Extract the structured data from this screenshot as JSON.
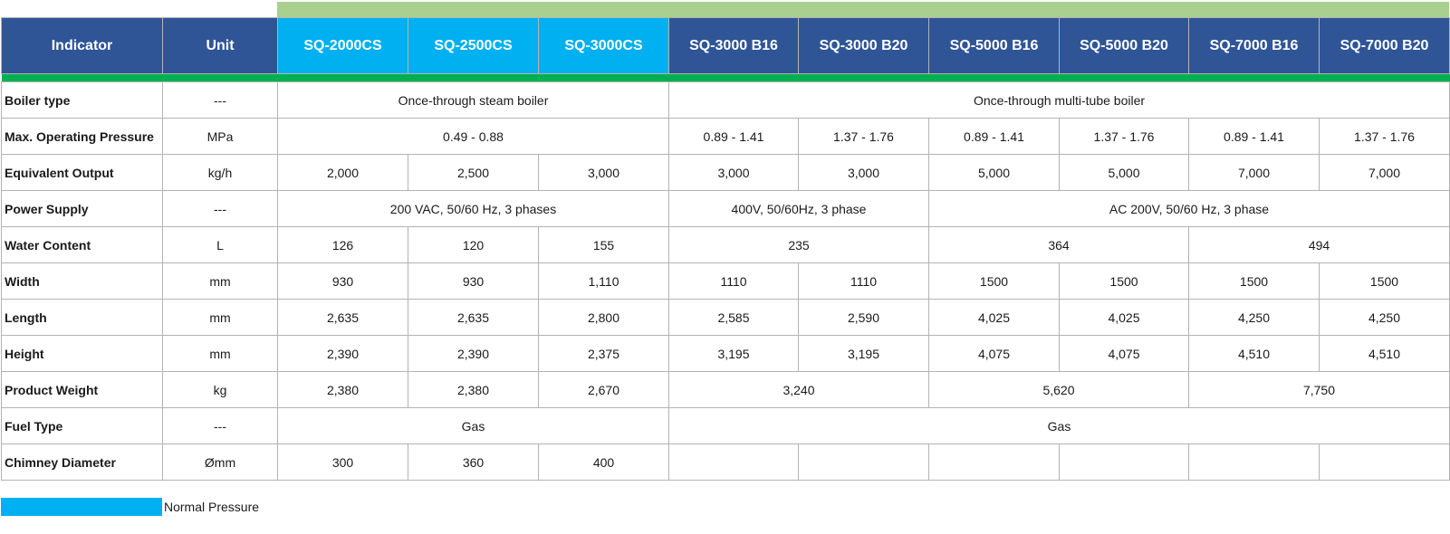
{
  "colors": {
    "header_dark": "#2f5597",
    "header_light": "#00b0f0",
    "top_bar": "#a9d08e",
    "accent_line": "#00b050",
    "border": "#b3b3b3"
  },
  "header": {
    "indicator": "Indicator",
    "unit": "Unit",
    "models": [
      "SQ-2000CS",
      "SQ-2500CS",
      "SQ-3000CS",
      "SQ-3000 B16",
      "SQ-3000 B20",
      "SQ-5000 B16",
      "SQ-5000 B20",
      "SQ-7000 B16",
      "SQ-7000 B20"
    ]
  },
  "rows": {
    "boiler_type": {
      "label": "Boiler type",
      "unit": "---",
      "cs": "Once-through steam boiler",
      "b": "Once-through multi-tube boiler"
    },
    "max_pressure": {
      "label": "Max. Operating Pressure",
      "unit": "MPa",
      "cs": "0.49 - 0.88",
      "b": [
        "0.89 - 1.41",
        "1.37 - 1.76",
        "0.89 - 1.41",
        "1.37 - 1.76",
        "0.89 - 1.41",
        "1.37 - 1.76"
      ]
    },
    "output": {
      "label": "Equivalent Output",
      "unit": "kg/h",
      "values": [
        "2,000",
        "2,500",
        "3,000",
        "3,000",
        "3,000",
        "5,000",
        "5,000",
        "7,000",
        "7,000"
      ]
    },
    "power": {
      "label": "Power Supply",
      "unit": "---",
      "cs": "200 VAC, 50/60 Hz, 3 phases",
      "b3000": "400V, 50/60Hz, 3 phase",
      "b5000_7000": "AC 200V, 50/60 Hz, 3 phase"
    },
    "water": {
      "label": "Water Content",
      "unit": "L",
      "cs": [
        "126",
        "120",
        "155"
      ],
      "b3000": "235",
      "b5000": "364",
      "b7000": "494"
    },
    "width": {
      "label": "Width",
      "unit": "mm",
      "values": [
        "930",
        "930",
        "1,110",
        "1110",
        "1110",
        "1500",
        "1500",
        "1500",
        "1500"
      ]
    },
    "length": {
      "label": "Length",
      "unit": "mm",
      "values": [
        "2,635",
        "2,635",
        "2,800",
        "2,585",
        "2,590",
        "4,025",
        "4,025",
        "4,250",
        "4,250"
      ]
    },
    "height": {
      "label": "Height",
      "unit": "mm",
      "values": [
        "2,390",
        "2,390",
        "2,375",
        "3,195",
        "3,195",
        "4,075",
        "4,075",
        "4,510",
        "4,510"
      ]
    },
    "weight": {
      "label": "Product Weight",
      "unit": "kg",
      "cs": [
        "2,380",
        "2,380",
        "2,670"
      ],
      "b3000": "3,240",
      "b5000": "5,620",
      "b7000": "7,750"
    },
    "fuel": {
      "label": "Fuel Type",
      "unit": "---",
      "cs": "Gas",
      "b": "Gas"
    },
    "chimney": {
      "label": "Chimney Diameter",
      "unit": "Ømm",
      "cs": [
        "300",
        "360",
        "400"
      ]
    }
  },
  "legend": {
    "label": "Normal Pressure",
    "color": "#00b0f0"
  }
}
